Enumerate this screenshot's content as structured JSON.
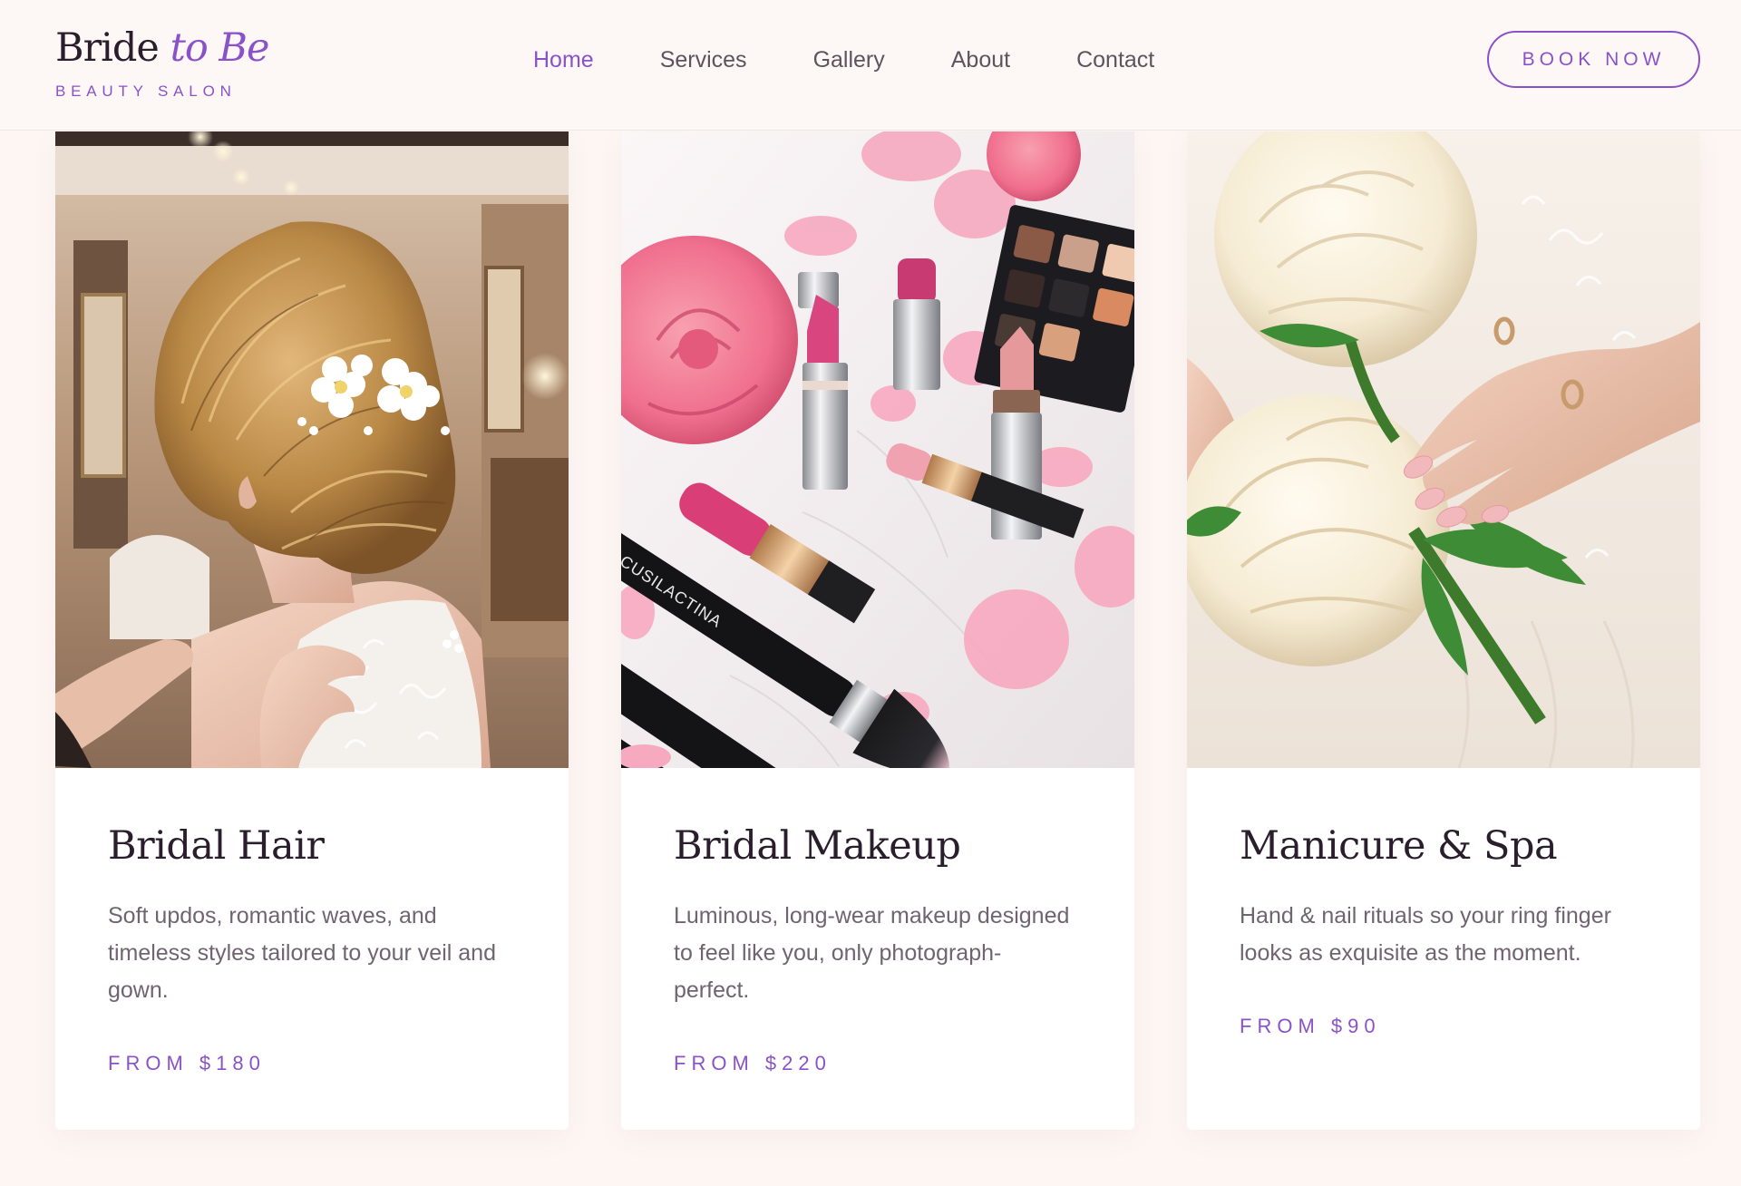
{
  "brand": {
    "name_main": "Bride",
    "name_accent": "to Be",
    "tagline": "BEAUTY SALON",
    "accent_color": "#8a52c8"
  },
  "nav": {
    "items": [
      {
        "label": "Home",
        "active": true
      },
      {
        "label": "Services",
        "active": false
      },
      {
        "label": "Gallery",
        "active": false
      },
      {
        "label": "About",
        "active": false
      },
      {
        "label": "Contact",
        "active": false
      }
    ],
    "cta_label": "BOOK NOW"
  },
  "services": [
    {
      "title": "Bridal Hair",
      "description": "Soft updos, romantic waves, and timeless styles tailored to your veil and gown.",
      "price": "FROM $180"
    },
    {
      "title": "Bridal Makeup",
      "description": "Luminous, long-wear makeup designed to feel like you, only photograph-perfect.",
      "price": "FROM $220"
    },
    {
      "title": "Manicure & Spa",
      "description": "Hand & nail rituals so your ring finger looks as exquisite as the moment.",
      "price": "FROM $90"
    }
  ],
  "photos": {
    "brush_brand": "CUSILACTINA"
  }
}
